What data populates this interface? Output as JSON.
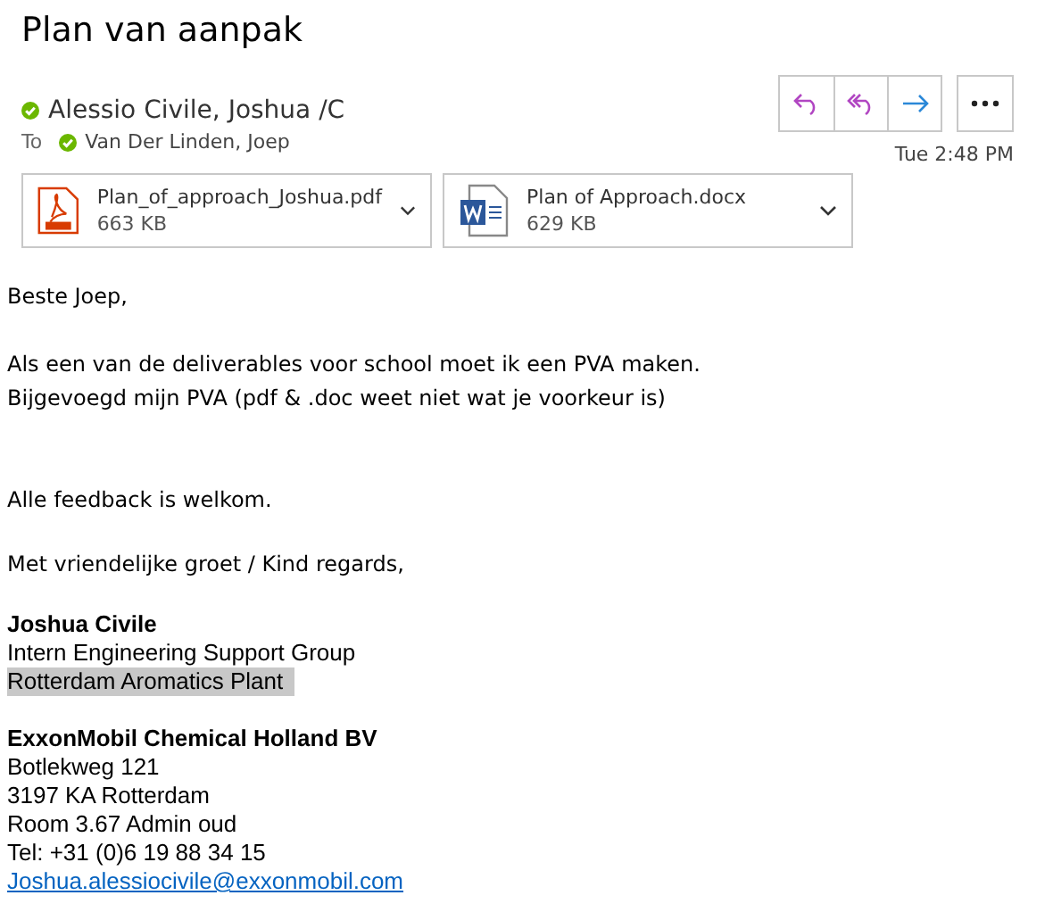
{
  "subject": "Plan van aanpak",
  "sender": {
    "name": "Alessio Civile, Joshua /C",
    "online": true
  },
  "to": {
    "label": "To",
    "recipients": [
      {
        "name": "Van Der Linden, Joep",
        "online": true
      }
    ]
  },
  "time": "Tue 2:48 PM",
  "actions": [
    {
      "kind": "reply"
    },
    {
      "kind": "reply-all"
    },
    {
      "kind": "forward"
    },
    {
      "kind": "more"
    }
  ],
  "attachments": [
    {
      "kind": "pdf",
      "name": "Plan_of_approach_Joshua.pdf",
      "size": "663 KB"
    },
    {
      "kind": "word",
      "name": "Plan of Approach.docx",
      "size": "629 KB"
    }
  ],
  "body": [
    {
      "lines": [
        "Beste Joep,"
      ]
    },
    {
      "lines": [
        "Als een van de deliverables voor school moet ik een PVA maken.",
        "Bijgevoegd mijn PVA (pdf & .doc weet niet wat je voorkeur is)"
      ]
    },
    {
      "lines": [
        "Alle feedback is welkom."
      ]
    },
    {
      "lines": [
        "Met vriendelijke groet / Kind regards,"
      ]
    }
  ],
  "signature": [
    {
      "lines": [
        {
          "kind": "bold",
          "text": "Joshua Civile",
          "highlighted": false
        },
        {
          "kind": "plain",
          "text": "Intern Engineering Support Group",
          "highlighted": false
        },
        {
          "kind": "plain",
          "text": "Rotterdam Aromatics Plant",
          "highlighted": true
        }
      ]
    },
    {
      "lines": [
        {
          "kind": "bold",
          "text": "ExxonMobil Chemical Holland BV",
          "highlighted": false
        },
        {
          "kind": "plain",
          "text": "Botlekweg 121",
          "highlighted": false
        },
        {
          "kind": "plain",
          "text": "3197 KA Rotterdam",
          "highlighted": false
        },
        {
          "kind": "plain",
          "text": "Room 3.67 Admin oud",
          "highlighted": false
        },
        {
          "kind": "plain",
          "text": "Tel: +31 (0)6 19 88 34 15",
          "highlighted": false
        },
        {
          "kind": "link",
          "text": "Joshua.alessiocivile@exxonmobil.com",
          "highlighted": false
        }
      ]
    }
  ]
}
